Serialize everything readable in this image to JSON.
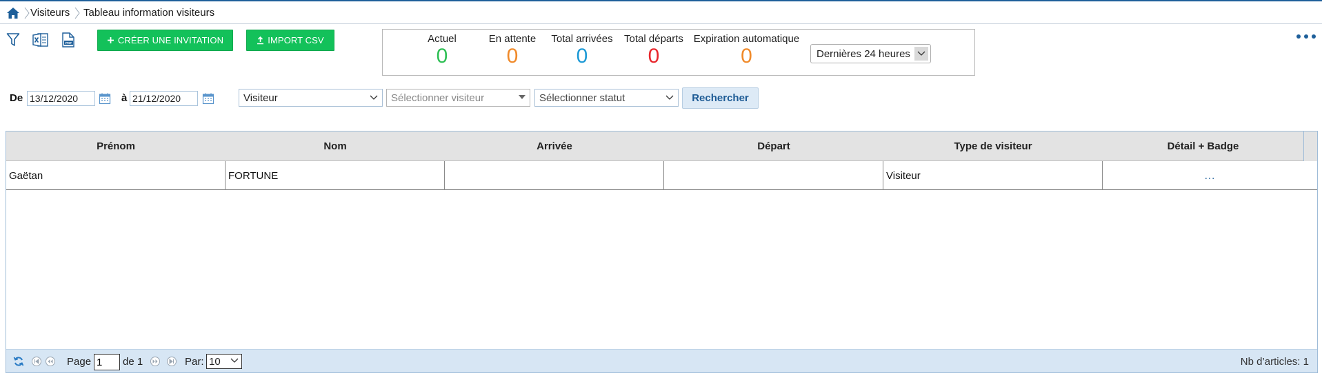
{
  "breadcrumb": {
    "items": [
      "Visiteurs",
      "Tableau information visiteurs"
    ]
  },
  "toolbar": {
    "create_invitation_label": "CRÉER UNE INVITATION",
    "import_csv_label": "IMPORT CSV",
    "icons": [
      "filter-icon",
      "excel-icon",
      "pdf-icon"
    ]
  },
  "stats": {
    "actuel": {
      "label": "Actuel",
      "value": "0",
      "color": "#2fbf55"
    },
    "en_attente": {
      "label": "En attente",
      "value": "0",
      "color": "#f08a2a"
    },
    "total_arrivees": {
      "label": "Total arrivées",
      "value": "0",
      "color": "#1e9ad6"
    },
    "total_departs": {
      "label": "Total départs",
      "value": "0",
      "color": "#e8262c"
    },
    "expiration": {
      "label": "Expiration automatique",
      "value": "0",
      "color": "#f08a2a"
    },
    "period": "Dernières 24 heures"
  },
  "filters": {
    "from_label": "De",
    "from_date": "13/12/2020",
    "to_label": "à",
    "to_date": "21/12/2020",
    "type_select": "Visiteur",
    "visitor_placeholder": "Sélectionner visiteur",
    "status_placeholder": "Sélectionner statut",
    "search_label": "Rechercher"
  },
  "table": {
    "columns": [
      "Prénom",
      "Nom",
      "Arrivée",
      "Départ",
      "Type de visiteur",
      "Détail + Badge"
    ],
    "rows": [
      [
        "Gaëtan",
        "FORTUNE",
        "",
        "",
        "Visiteur",
        "..."
      ]
    ]
  },
  "pager": {
    "page_label": "Page",
    "page_value": "1",
    "of_label": "de 1",
    "per_label": "Par:",
    "per_value": "10",
    "count_label": "Nb d’articles: 1"
  },
  "colors": {
    "brand": "#1e5f9a",
    "green_button": "#13c15a"
  }
}
